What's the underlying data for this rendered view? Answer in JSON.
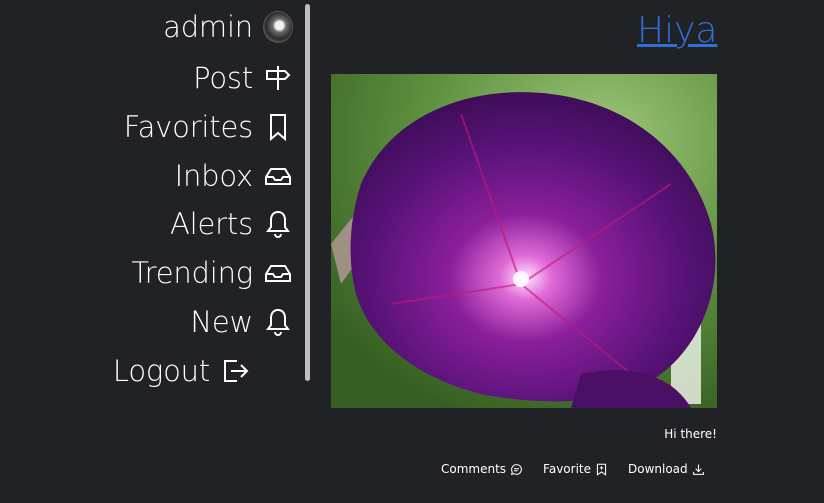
{
  "sidebar": {
    "items": [
      {
        "label": "admin",
        "icon": "avatar"
      },
      {
        "label": "Post",
        "icon": "signpost-icon"
      },
      {
        "label": "Favorites",
        "icon": "bookmark-icon"
      },
      {
        "label": "Inbox",
        "icon": "inbox-icon"
      },
      {
        "label": "Alerts",
        "icon": "bell-icon"
      },
      {
        "label": "Trending",
        "icon": "inbox-icon"
      },
      {
        "label": "New",
        "icon": "bell-icon"
      },
      {
        "label": "Logout",
        "icon": "logout-icon"
      }
    ]
  },
  "post": {
    "title": "Hiya",
    "caption": "Hi there!",
    "image_alt": "purple morning glory flower",
    "actions": {
      "comments": "Comments",
      "favorite": "Favorite",
      "download": "Download"
    }
  },
  "colors": {
    "background": "#202226",
    "link": "#2f6fd6",
    "text": "#ffffff"
  }
}
